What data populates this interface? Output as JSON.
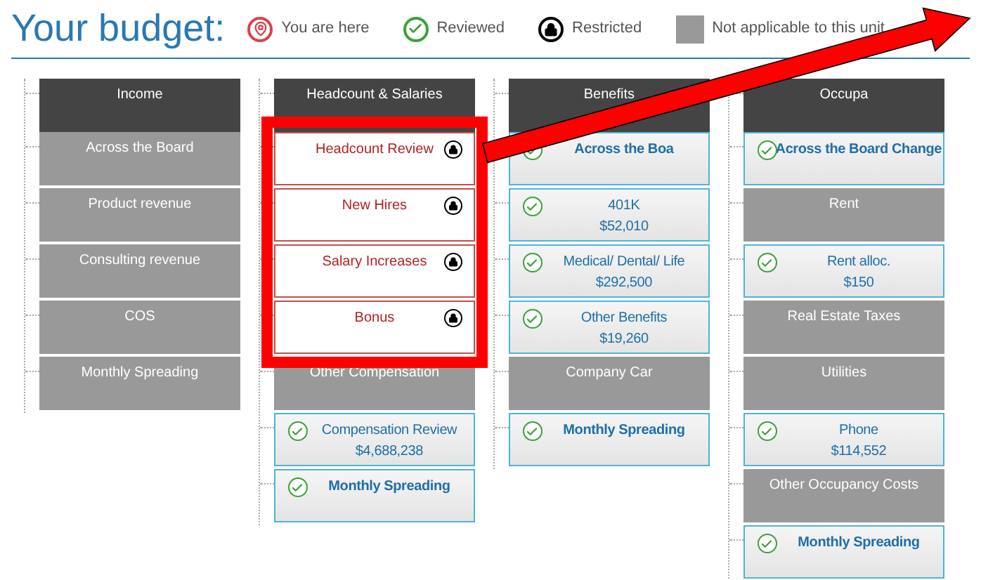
{
  "title": "Your budget:",
  "legend": [
    {
      "kind": "here",
      "label": "You are here"
    },
    {
      "kind": "reviewed",
      "label": "Reviewed"
    },
    {
      "kind": "restricted",
      "label": "Restricted"
    },
    {
      "kind": "na",
      "label": "Not applicable to this unit"
    }
  ],
  "columns": [
    {
      "title": "Income",
      "cells": [
        {
          "kind": "na",
          "label": "Across the Board"
        },
        {
          "kind": "na",
          "label": "Product revenue"
        },
        {
          "kind": "na",
          "label": "Consulting revenue"
        },
        {
          "kind": "na",
          "label": "COS"
        },
        {
          "kind": "na",
          "label": "Monthly Spreading"
        }
      ]
    },
    {
      "title": "Headcount & Salaries",
      "cells": [
        {
          "kind": "restricted",
          "label": "Headcount Review"
        },
        {
          "kind": "restricted",
          "label": "New Hires"
        },
        {
          "kind": "restricted",
          "label": "Salary Increases"
        },
        {
          "kind": "restricted",
          "label": "Bonus"
        },
        {
          "kind": "na",
          "label": "Other Compensation"
        },
        {
          "kind": "reviewed",
          "label": "Compensation Review",
          "amount": "$4,688,238"
        },
        {
          "kind": "reviewed",
          "label": "Monthly Spreading"
        }
      ]
    },
    {
      "title": "Benefits",
      "cells": [
        {
          "kind": "reviewed",
          "label": "Across the Boa"
        },
        {
          "kind": "reviewed",
          "label": "401K",
          "amount": "$52,010"
        },
        {
          "kind": "reviewed",
          "label": "Medical/ Dental/ Life",
          "amount": "$292,500"
        },
        {
          "kind": "reviewed",
          "label": "Other Benefits",
          "amount": "$19,260"
        },
        {
          "kind": "na",
          "label": "Company Car"
        },
        {
          "kind": "reviewed",
          "label": "Monthly Spreading"
        }
      ]
    },
    {
      "title": "Occupa",
      "cells": [
        {
          "kind": "reviewed",
          "label": "Across the Board Change"
        },
        {
          "kind": "na",
          "label": "Rent"
        },
        {
          "kind": "reviewed",
          "label": "Rent alloc.",
          "amount": "$150"
        },
        {
          "kind": "na",
          "label": "Real Estate Taxes"
        },
        {
          "kind": "na",
          "label": "Utilities"
        },
        {
          "kind": "reviewed",
          "label": "Phone",
          "amount": "$114,552"
        },
        {
          "kind": "na",
          "label": "Other Occupancy Costs"
        },
        {
          "kind": "reviewed",
          "label": "Monthly Spreading"
        }
      ]
    }
  ]
}
